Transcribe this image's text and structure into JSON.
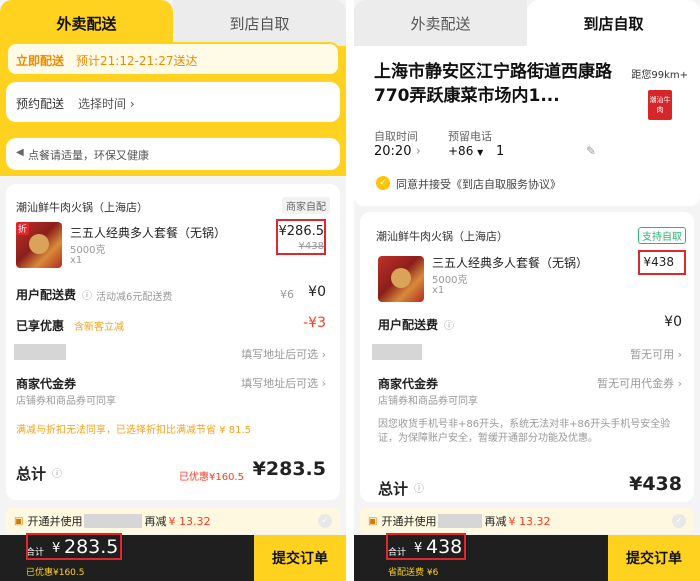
{
  "left": {
    "tabs": {
      "active": "外卖配送",
      "inactive": "到店自取"
    },
    "delivery": {
      "immediate": "立即配送",
      "eta": "预计21:12-21:27送达"
    },
    "schedule": {
      "label": "预约配送",
      "value": "选择时间"
    },
    "notice": "点餐请适量，环保又健康",
    "store": {
      "name": "潮汕鲜牛肉火锅（上海店）",
      "badge": "商家自配"
    },
    "item": {
      "discount_tag": "折",
      "name": "三五人经典多人套餐（无锅）",
      "weight": "5000克",
      "qty": "x1",
      "price": "¥286.5",
      "orig_price": "¥438"
    },
    "delivery_fee": {
      "label": "用户配送费",
      "hint": "活动减6元配送费",
      "orig": "¥6",
      "value": "¥0"
    },
    "discount": {
      "label": "已享优惠",
      "hint": "含新客立减",
      "value": "-¥3"
    },
    "blurred_row": {
      "value": "填写地址后可选"
    },
    "voucher": {
      "label": "商家代金券",
      "hint": "填写地址后可选",
      "sub": "店铺券和商品券可同享"
    },
    "combo_note": "满减与折扣无法同享，已选择折扣比满减节省 ¥ 81.5",
    "total": {
      "label": "总计",
      "saved": "已优惠¥160.5",
      "value": "¥283.5"
    },
    "promo": {
      "prefix": "开通并使用",
      "suffix": "再减",
      "amount": "¥ 13.32"
    },
    "bottom": {
      "label": "合计",
      "currency": "¥",
      "amount": "283.5",
      "saved": "已优惠¥160.5",
      "submit": "提交订单"
    }
  },
  "right": {
    "tabs": {
      "inactive": "外卖配送",
      "active": "到店自取"
    },
    "address": "上海市静安区江宁路街道西康路770弄跃康菜市场内1...",
    "distance": "距您99km+",
    "store_logo_text": "潮汕牛肉",
    "pickup": {
      "label": "自取时间",
      "value": "20:20"
    },
    "phone": {
      "label": "预留电话",
      "code": "+86",
      "value": "1"
    },
    "agreement": "同意并接受《到店自取服务协议》",
    "store": {
      "name": "潮汕鲜牛肉火锅（上海店）",
      "badge": "支持自取"
    },
    "item": {
      "name": "三五人经典多人套餐（无锅）",
      "weight": "5000克",
      "qty": "x1",
      "price": "¥438"
    },
    "delivery_fee": {
      "label": "用户配送费",
      "value": "¥0"
    },
    "blurred_row": {
      "value": "暂无可用"
    },
    "voucher": {
      "label": "商家代金券",
      "hint": "暂无可用代金券",
      "sub": "店铺券和商品券可同享"
    },
    "phone_warning": "因您收货手机号非+86开头，系统无法对非+86开头手机号安全验证，为保障账户安全，暂缓开通部分功能及优惠。",
    "total": {
      "label": "总计",
      "value": "¥438"
    },
    "promo": {
      "prefix": "开通并使用",
      "suffix": "再减",
      "amount": "¥ 13.32"
    },
    "bottom": {
      "label": "合计",
      "currency": "¥",
      "amount": "438",
      "saved": "省配送费 ¥6",
      "submit": "提交订单"
    }
  },
  "colors": {
    "accent_yellow": "#ffd21f",
    "price_red": "#ff3b1f",
    "highlight_box": "#e0262e",
    "green_badge": "#2bb673"
  }
}
